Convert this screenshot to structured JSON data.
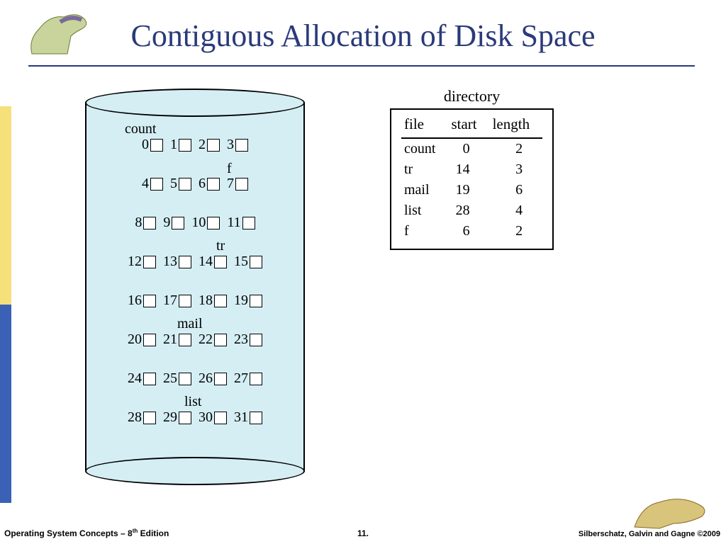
{
  "title": "Contiguous Allocation of Disk Space",
  "footer": {
    "left_prefix": "Operating System Concepts – 8",
    "left_suffix": " Edition",
    "left_sup": "th",
    "center": "11.",
    "right": "Silberschatz, Galvin and Gagne ©2009"
  },
  "directory": {
    "title": "directory",
    "headers": [
      "file",
      "start",
      "length"
    ],
    "rows": [
      {
        "file": "count",
        "start": 0,
        "length": 2
      },
      {
        "file": "tr",
        "start": 14,
        "length": 3
      },
      {
        "file": "mail",
        "start": 19,
        "length": 6
      },
      {
        "file": "list",
        "start": 28,
        "length": 4
      },
      {
        "file": "f",
        "start": 6,
        "length": 2
      }
    ]
  },
  "disk": {
    "labels": {
      "count": "count",
      "f": "f",
      "tr": "tr",
      "mail": "mail",
      "list": "list"
    },
    "blocks": [
      0,
      1,
      2,
      3,
      4,
      5,
      6,
      7,
      8,
      9,
      10,
      11,
      12,
      13,
      14,
      15,
      16,
      17,
      18,
      19,
      20,
      21,
      22,
      23,
      24,
      25,
      26,
      27,
      28,
      29,
      30,
      31
    ]
  }
}
